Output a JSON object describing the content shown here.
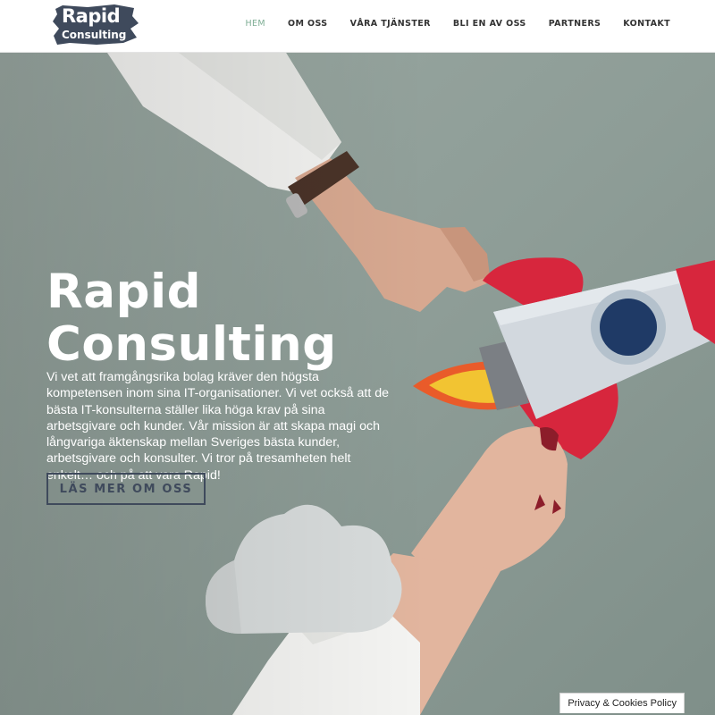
{
  "logo": {
    "line1": "Rapid",
    "line2": "Consulting"
  },
  "nav": {
    "items": [
      {
        "label": "HEM",
        "active": true
      },
      {
        "label": "OM OSS",
        "active": false
      },
      {
        "label": "VÅRA TJÄNSTER",
        "active": false
      },
      {
        "label": "BLI EN AV OSS",
        "active": false
      },
      {
        "label": "PARTNERS",
        "active": false
      },
      {
        "label": "KONTAKT",
        "active": false
      }
    ]
  },
  "hero": {
    "title_line1": "Rapid",
    "title_line2": "Consulting",
    "text": "Vi vet att framgångsrika bolag kräver den högsta kompetensen inom sina IT-organisationer. Vi vet också att de bästa IT-konsulterna ställer lika höga krav på sina arbetsgivare och kunder. Vår mission är att skapa magi och långvariga äktenskap mellan Sveriges bästa kunder, arbetsgivare och konsulter. Vi tror på tresamheten helt enkelt… och på att vara Rapid!",
    "button_label": "LÄS MER OM OSS"
  },
  "cookie": {
    "label": "Privacy & Cookies Policy"
  },
  "colors": {
    "accent_active": "#7fae95",
    "hero_background": "#8a9a94",
    "logo_background": "#3f4a5c",
    "button_border": "#3f4a5c"
  },
  "illustration": {
    "icons": [
      "rocket-illustration",
      "cloud-illustration",
      "hand-illustration"
    ]
  }
}
